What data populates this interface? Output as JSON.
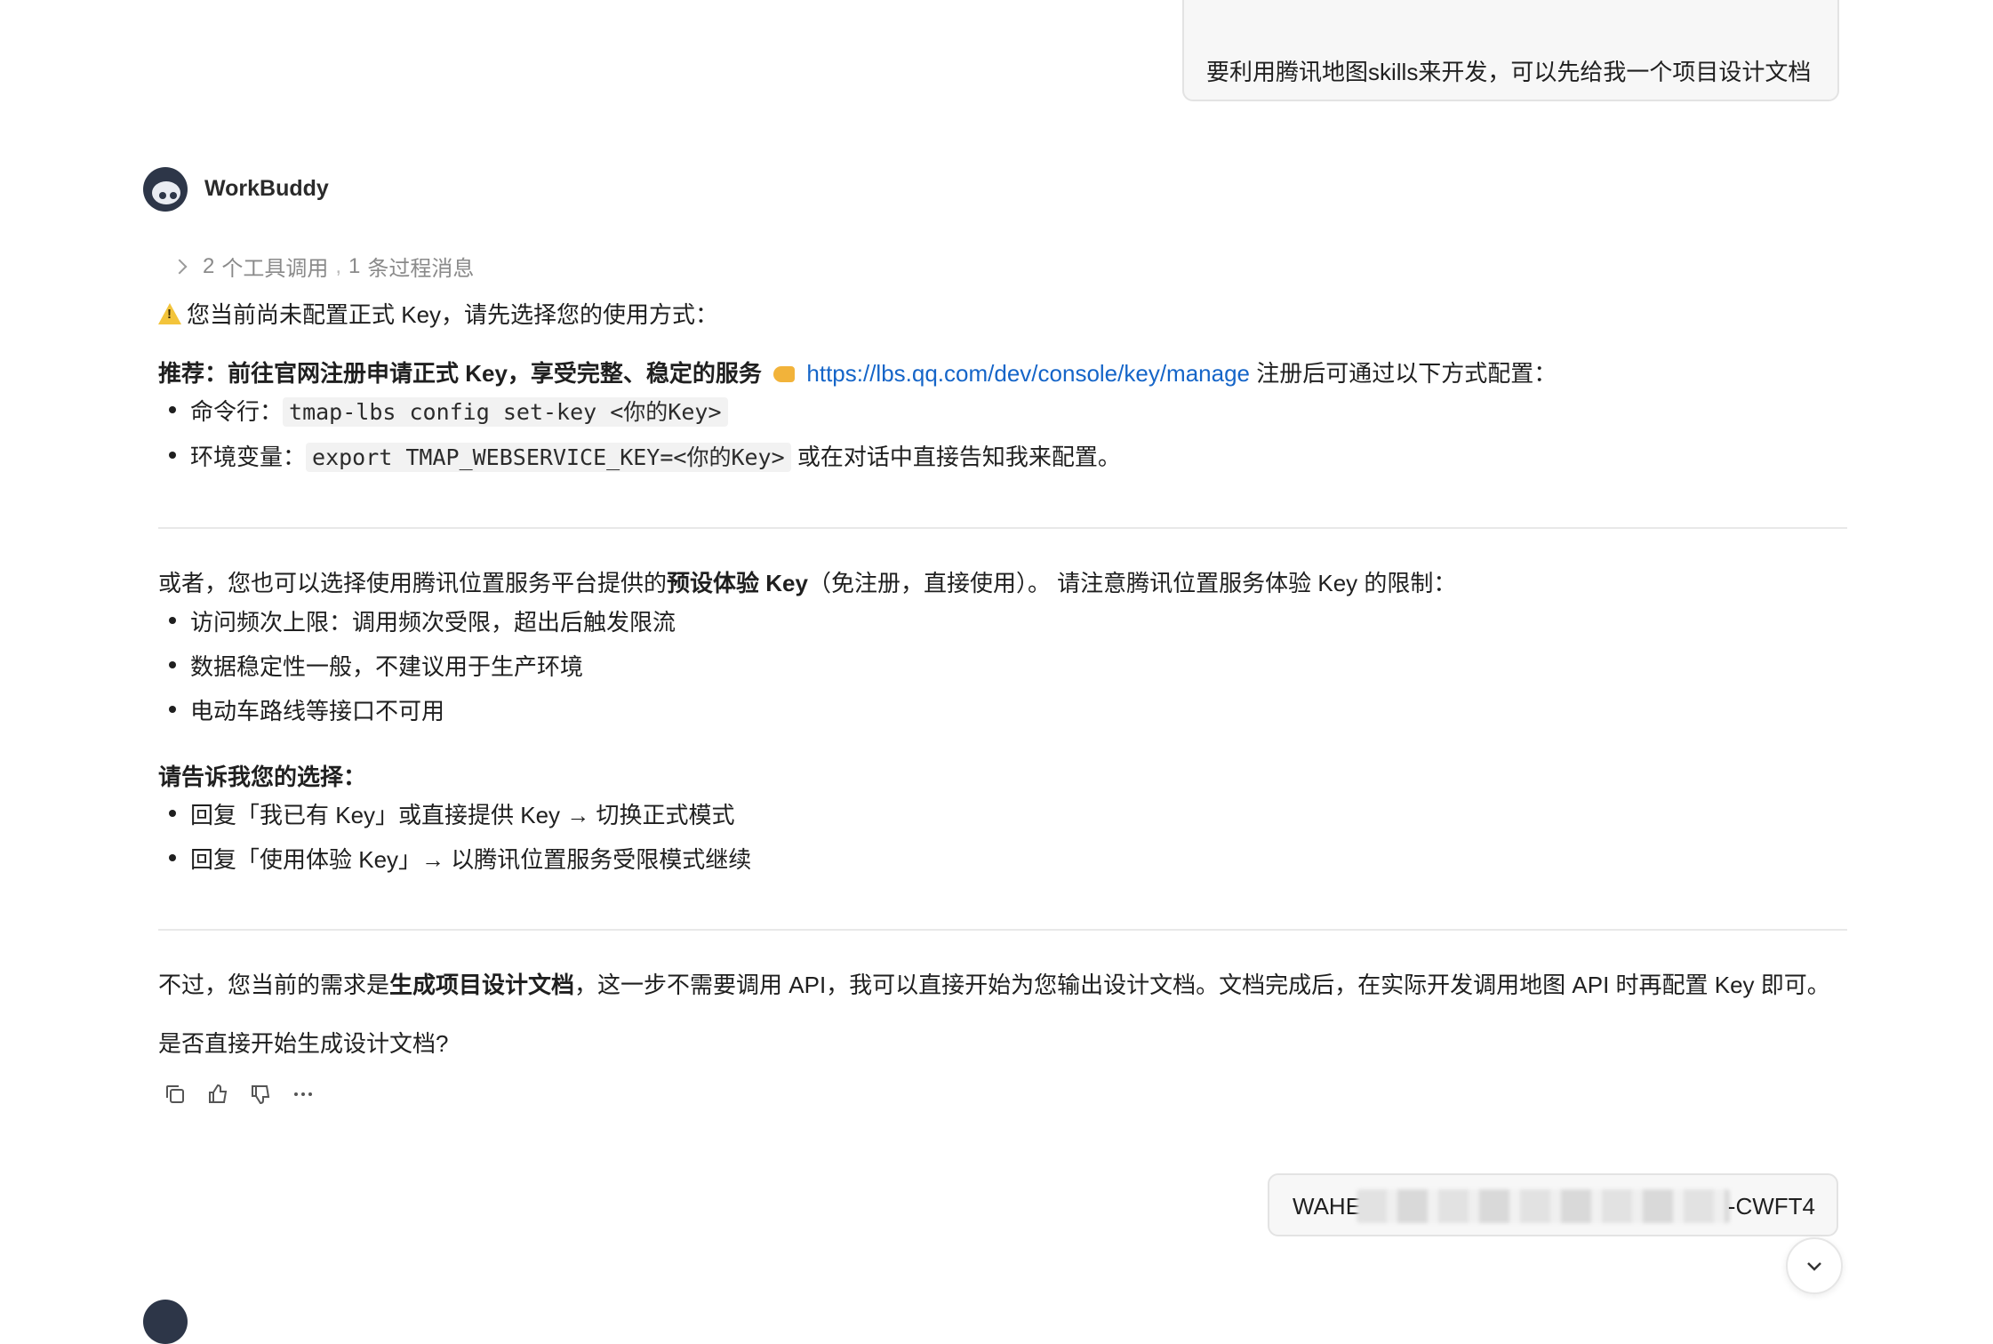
{
  "user_message_1": "要利用腾讯地图skills来开发，可以先给我一个项目设计文档",
  "bot": {
    "name": "WorkBuddy"
  },
  "tool_summary": {
    "count_tools": "2",
    "tools_label": "个工具调用",
    "separator": ",",
    "count_msgs": "1",
    "msgs_label": "条过程消息"
  },
  "warning_text": "您当前尚未配置正式 Key，请先选择您的使用方式：",
  "recommend": {
    "bold": "推荐：前往官网注册申请正式 Key，享受完整、稳定的服务",
    "url": "https://lbs.qq.com/dev/console/key/manage",
    "after": " 注册后可通过以下方式配置："
  },
  "config_items": [
    {
      "label": "命令行：",
      "code": "tmap-lbs config set-key <你的Key>",
      "tail": ""
    },
    {
      "label": "环境变量：",
      "code": "export TMAP_WEBSERVICE_KEY=<你的Key>",
      "tail": " 或在对话中直接告知我来配置。"
    }
  ],
  "alt": {
    "prefix": "或者，您也可以选择使用腾讯位置服务平台提供的",
    "bold": "预设体验 Key",
    "suffix": "（免注册，直接使用）。 请注意腾讯位置服务体验 Key 的限制："
  },
  "limits": [
    "访问频次上限：调用频次受限，超出后触发限流",
    "数据稳定性一般，不建议用于生产环境",
    "电动车路线等接口不可用"
  ],
  "choice_heading": "请告诉我您的选择：",
  "choices": [
    "回复「我已有 Key」或直接提供 Key → 切换正式模式",
    "回复「使用体验 Key」→ 以腾讯位置服务受限模式继续"
  ],
  "note": {
    "prefix": "不过，您当前的需求是",
    "bold": "生成项目设计文档",
    "suffix": "，这一步不需要调用 API，我可以直接开始为您输出设计文档。文档完成后，在实际开发调用地图 API 时再配置 Key 即可。"
  },
  "question": "是否直接开始生成设计文档?",
  "user_message_2": {
    "start": "WAHE",
    "end": "-CWFT4"
  },
  "icons": [
    "copy-icon",
    "thumbs-up-icon",
    "thumbs-down-icon",
    "more-icon",
    "chevron-down-icon"
  ]
}
